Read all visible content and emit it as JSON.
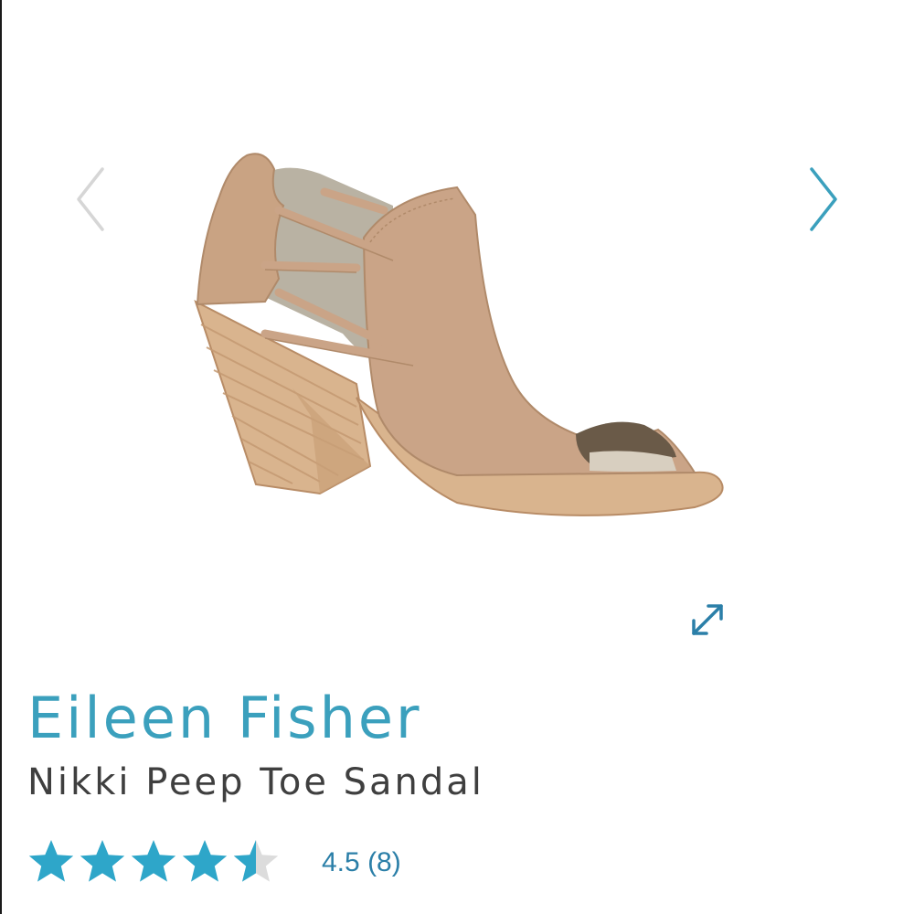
{
  "product": {
    "brand": "Eileen Fisher",
    "name": "Nikki Peep Toe Sandal"
  },
  "rating": {
    "value": 4.5,
    "max": 5,
    "value_label": "4.5",
    "count_label": "(8)"
  },
  "gallery": {
    "prev_icon": "chevron-left-icon",
    "next_icon": "chevron-right-icon",
    "expand_icon": "expand-arrows-icon",
    "image_subject": "tan suede peep toe sandal with stacked heel"
  },
  "colors": {
    "accent": "#3ba0bd",
    "link": "#2b7fa8",
    "star_filled": "#2ea6c9",
    "star_empty": "#dcdcdc",
    "arrow_disabled": "#d6d6d6",
    "text": "#3f3f3f"
  }
}
